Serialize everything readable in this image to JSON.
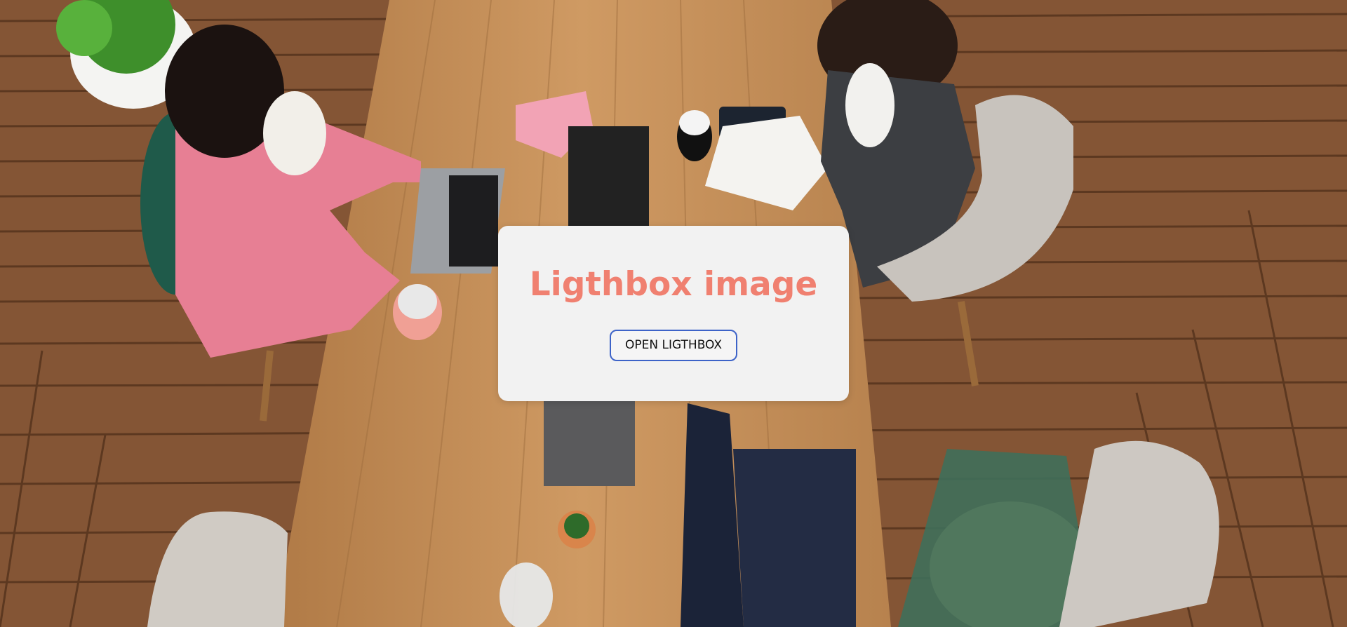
{
  "background": {
    "description_icon": "office-photo",
    "floor_color": "#7a4e2f",
    "table_color": "#c48c55"
  },
  "lightbox_card": {
    "title": "Ligthbox image",
    "button_label": "OPEN LIGTHBOX",
    "title_color": "#f08070",
    "button_border_color": "#3d63c8",
    "card_color": "#f2f2f2"
  }
}
